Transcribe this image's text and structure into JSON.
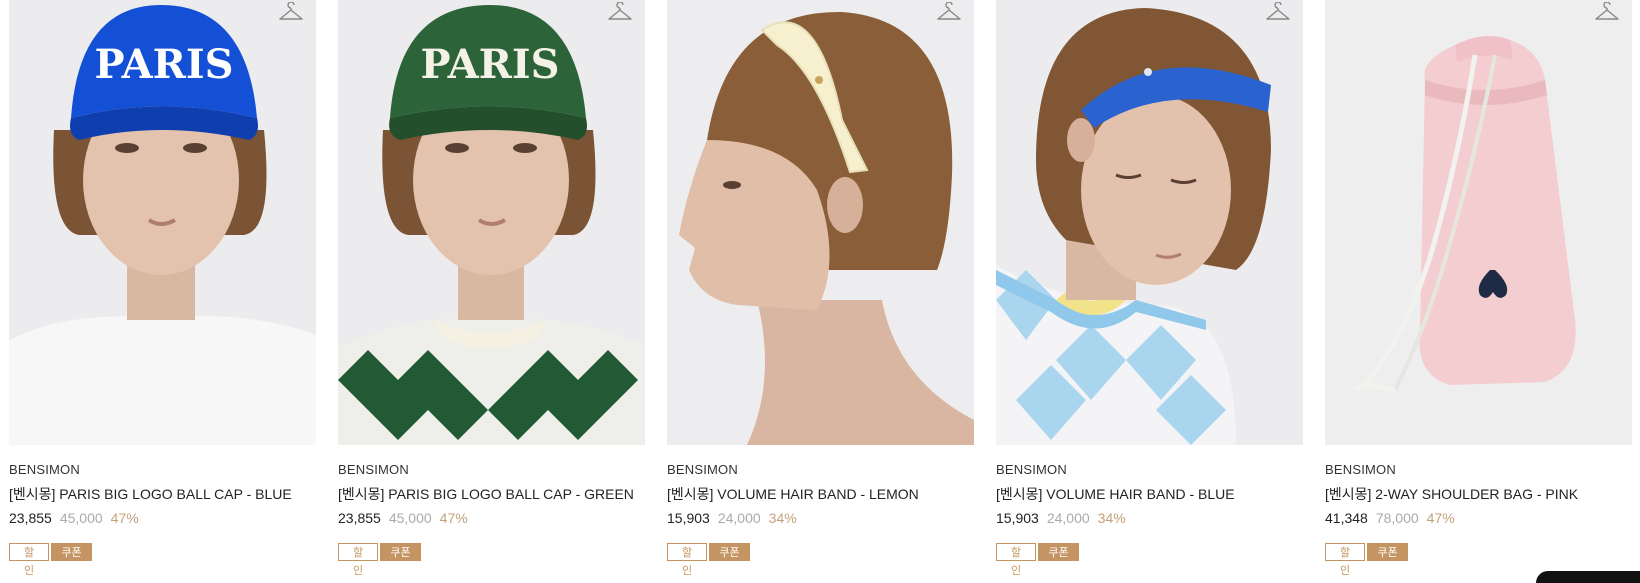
{
  "products": [
    {
      "brand": "BENSIMON",
      "name": "[벤시몽] PARIS BIG LOGO BALL CAP - BLUE",
      "price": "23,855",
      "original_price": "45,000",
      "discount": "47%",
      "badge_sale": "할인",
      "badge_coupon": "쿠폰",
      "cap_text": "PARIS",
      "wish_icon": "hanger-icon"
    },
    {
      "brand": "BENSIMON",
      "name": "[벤시몽] PARIS BIG LOGO BALL CAP - GREEN",
      "price": "23,855",
      "original_price": "45,000",
      "discount": "47%",
      "badge_sale": "할인",
      "badge_coupon": "쿠폰",
      "cap_text": "PARIS",
      "wish_icon": "hanger-icon"
    },
    {
      "brand": "BENSIMON",
      "name": "[벤시몽] VOLUME HAIR BAND - LEMON",
      "price": "15,903",
      "original_price": "24,000",
      "discount": "34%",
      "badge_sale": "할인",
      "badge_coupon": "쿠폰",
      "wish_icon": "hanger-icon"
    },
    {
      "brand": "BENSIMON",
      "name": "[벤시몽] VOLUME HAIR BAND - BLUE",
      "price": "15,903",
      "original_price": "24,000",
      "discount": "34%",
      "badge_sale": "할인",
      "badge_coupon": "쿠폰",
      "wish_icon": "hanger-icon"
    },
    {
      "brand": "BENSIMON",
      "name": "[벤시몽] 2-WAY SHOULDER BAG - PINK",
      "price": "41,348",
      "original_price": "78,000",
      "discount": "47%",
      "badge_sale": "할인",
      "badge_coupon": "쿠폰",
      "wish_icon": "hanger-icon"
    }
  ],
  "colors": {
    "accent": "#c49563",
    "discount_text": "#c4a07a",
    "original_price_text": "#aaaaaa"
  }
}
